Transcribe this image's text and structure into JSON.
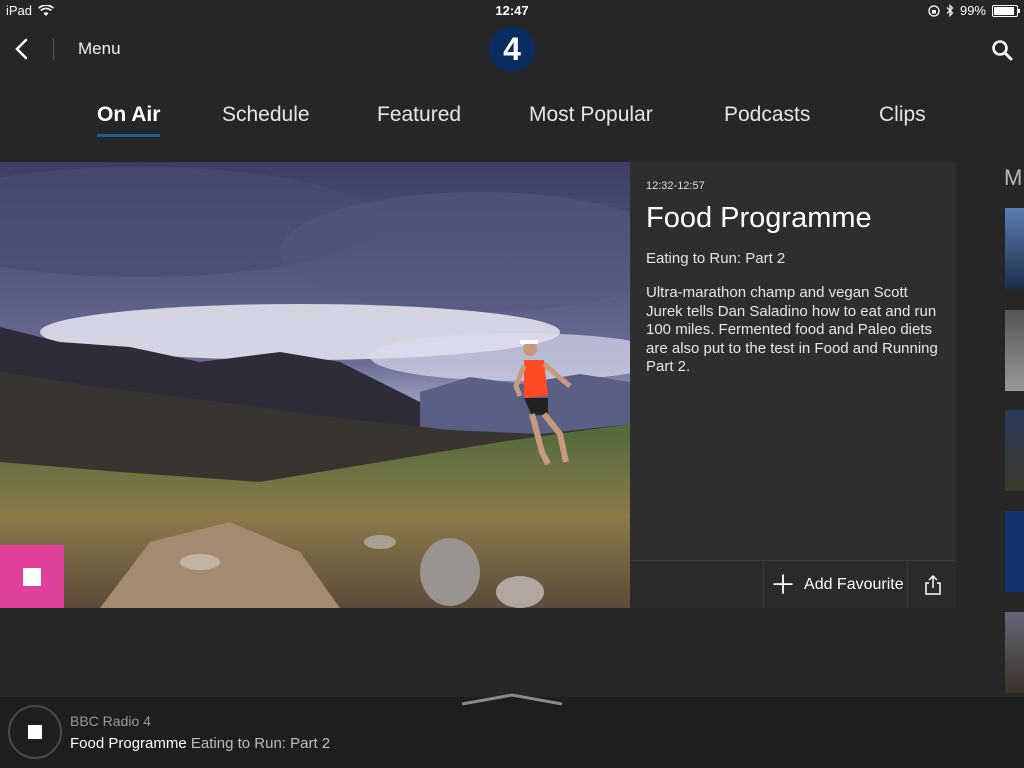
{
  "status_bar": {
    "device": "iPad",
    "time": "12:47",
    "battery_text": "99%",
    "battery_level": 0.99
  },
  "top_bar": {
    "menu_label": "Menu",
    "logo_text": "4"
  },
  "tabs": [
    {
      "label": "On Air",
      "active": true
    },
    {
      "label": "Schedule"
    },
    {
      "label": "Featured"
    },
    {
      "label": "Most Popular"
    },
    {
      "label": "Podcasts"
    },
    {
      "label": "Clips"
    }
  ],
  "programme": {
    "time_range": "12:32-12:57",
    "title": "Food Programme",
    "subtitle": "Eating to Run: Part 2",
    "description": "Ultra-marathon champ and vegan Scott Jurek tells Dan Saladino how to eat and run 100 miles. Fermented food and Paleo diets are also put to the test in Food and Running Part 2.",
    "add_favourite_label": "Add Favourite"
  },
  "right_edge": {
    "letter": "M"
  },
  "player": {
    "station": "BBC Radio 4",
    "programme": "Food Programme",
    "episode": "Eating to Run: Part 2"
  },
  "colors": {
    "accent_pink": "#e0409a",
    "tab_underline": "#1f5d8c",
    "logo_blue": "#0b2c61"
  }
}
